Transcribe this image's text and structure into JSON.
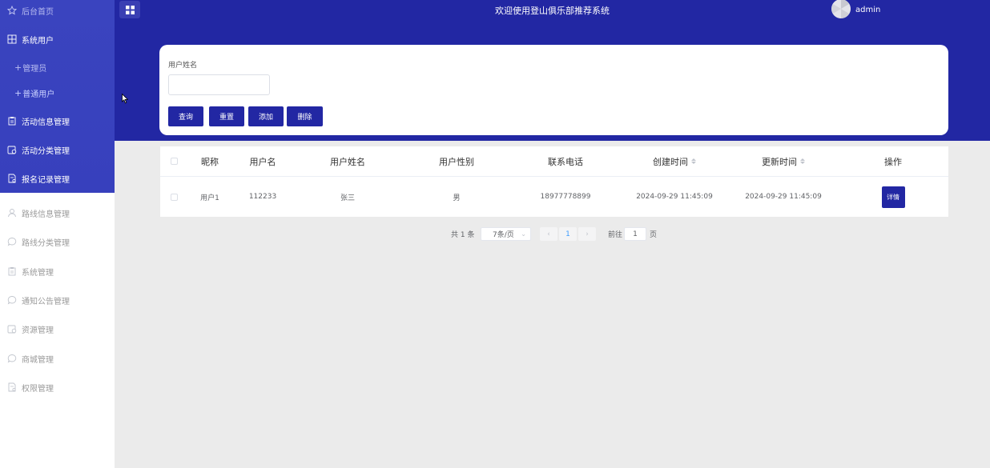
{
  "sidebar": {
    "items": [
      {
        "label": "后台首页",
        "icon": "star-icon"
      },
      {
        "label": "系统用户",
        "icon": "grid-icon"
      },
      {
        "label": "管理员",
        "icon": "plus"
      },
      {
        "label": "普通用户",
        "icon": "plus"
      },
      {
        "label": "活动信息管理",
        "icon": "clipboard-icon"
      },
      {
        "label": "活动分类管理",
        "icon": "calendar-icon"
      },
      {
        "label": "报名记录管理",
        "icon": "document-icon"
      },
      {
        "label": "路线信息管理",
        "icon": "user-icon"
      },
      {
        "label": "路线分类管理",
        "icon": "chat-icon"
      },
      {
        "label": "系统管理",
        "icon": "clipboard-icon"
      },
      {
        "label": "通知公告管理",
        "icon": "chat-icon"
      },
      {
        "label": "资源管理",
        "icon": "calendar-icon"
      },
      {
        "label": "商城管理",
        "icon": "chat-icon"
      },
      {
        "label": "权限管理",
        "icon": "document-icon"
      }
    ]
  },
  "header": {
    "title": "欢迎使用登山俱乐部推荐系统",
    "username": "admin"
  },
  "search": {
    "label": "用户姓名",
    "value": "",
    "buttons": {
      "query": "查询",
      "reset": "重置",
      "add": "添加",
      "delete": "删除"
    }
  },
  "table": {
    "columns": [
      "昵称",
      "用户名",
      "用户姓名",
      "用户性别",
      "联系电话",
      "创建时间",
      "更新时间",
      "操作"
    ],
    "rows": [
      {
        "nickname": "用户1",
        "username": "112233",
        "realname": "张三",
        "gender": "男",
        "phone": "18977778899",
        "created": "2024-09-29 11:45:09",
        "updated": "2024-09-29 11:45:09",
        "action": "详情"
      }
    ]
  },
  "pagination": {
    "total_text": "共 1 条",
    "page_size": "7条/页",
    "prev": "‹",
    "current": "1",
    "next": "›",
    "goto_label": "前往",
    "goto_value": "1",
    "page_suffix": "页"
  },
  "colors": {
    "primary": "#2227a3",
    "sidebar_blue": "#3a44bf"
  }
}
